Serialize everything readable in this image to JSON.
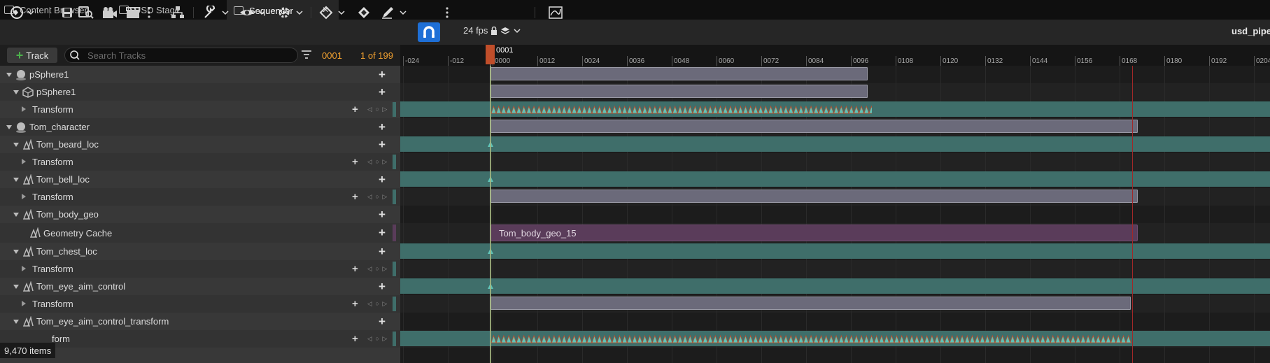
{
  "tabs": [
    {
      "label": "Content Browser",
      "icon": "content-browser-icon"
    },
    {
      "label": "USD Stage",
      "icon": "usd-stage-icon"
    },
    {
      "label": "Sequencer",
      "icon": "sequencer-icon",
      "active": true,
      "close": "×"
    }
  ],
  "toolbar": {
    "fps_label": "24 fps",
    "title": "usd_pipel",
    "accent": "#1e6fd6"
  },
  "trackbar": {
    "add_track_label": "Track",
    "search_placeholder": "Search Tracks",
    "current_frame": "0001",
    "frame_count": "1 of 199"
  },
  "ruler": {
    "playhead_label": "0001",
    "ticks": [
      "-024",
      "-012",
      "0000",
      "0012",
      "0024",
      "0036",
      "0048",
      "0060",
      "0072",
      "0084",
      "0096",
      "0108",
      "0120",
      "0132",
      "0144",
      "0156",
      "0168",
      "0180",
      "0192",
      "0204"
    ]
  },
  "tracks": [
    {
      "label": "pSphere1",
      "kind": "actor"
    },
    {
      "label": "pSphere1",
      "kind": "component"
    },
    {
      "label": "Transform",
      "kind": "transform"
    },
    {
      "label": "Tom_character",
      "kind": "actor"
    },
    {
      "label": "Tom_beard_loc",
      "kind": "component"
    },
    {
      "label": "Transform",
      "kind": "transform"
    },
    {
      "label": "Tom_bell_loc",
      "kind": "component"
    },
    {
      "label": "Transform",
      "kind": "transform"
    },
    {
      "label": "Tom_body_geo",
      "kind": "component"
    },
    {
      "label": "Geometry Cache",
      "kind": "geocache"
    },
    {
      "label": "Tom_chest_loc",
      "kind": "component"
    },
    {
      "label": "Transform",
      "kind": "transform"
    },
    {
      "label": "Tom_eye_aim_control",
      "kind": "component"
    },
    {
      "label": "Transform",
      "kind": "transform"
    },
    {
      "label": "Tom_eye_aim_control_transform",
      "kind": "component"
    },
    {
      "label": "form",
      "kind": "transform"
    }
  ],
  "geometry_cache_section": "Tom_body_geo_15",
  "status": {
    "items_label": "9,470 items"
  },
  "colors": {
    "transform_lane": "#3f6e6a",
    "section": "#6b6a7a",
    "geocache": "#5a3c5a",
    "playhead": "#c04e2a",
    "frame_text": "#f0a030"
  }
}
